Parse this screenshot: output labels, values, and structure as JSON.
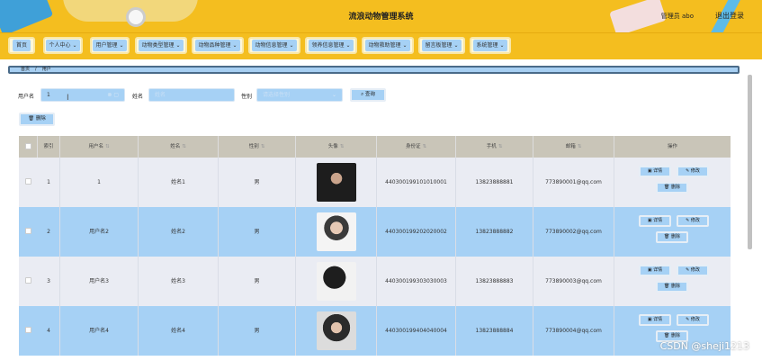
{
  "header": {
    "title": "流浪动物管理系统",
    "user_info": "管理员 abo",
    "logout": "退出登录"
  },
  "nav": [
    {
      "label": "首页"
    },
    {
      "label": "个人中心 ⌄"
    },
    {
      "label": "用户管理 ⌄"
    },
    {
      "label": "动物类型管理 ⌄"
    },
    {
      "label": "动物品种管理 ⌄"
    },
    {
      "label": "动物信息管理 ⌄"
    },
    {
      "label": "领养信息管理 ⌄"
    },
    {
      "label": "动物救助管理 ⌄"
    },
    {
      "label": "留言板管理 ⌄"
    },
    {
      "label": "系统管理 ⌄"
    }
  ],
  "breadcrumb": {
    "home": "首页",
    "separator": "/",
    "current": "用户"
  },
  "search": {
    "username_label": "用户名",
    "username_value": "1",
    "name_label": "姓名",
    "name_placeholder": "姓名",
    "gender_label": "性别",
    "gender_placeholder": "请选择性别",
    "query_button": "⌕ 查询",
    "delete_button": "🗑 删除"
  },
  "table": {
    "headers": [
      "索引",
      "用户名",
      "姓名",
      "性别",
      "头像",
      "身份证",
      "手机",
      "邮箱",
      "操作"
    ],
    "rows": [
      {
        "index": "1",
        "username": "1",
        "name": "姓名1",
        "gender": "男",
        "id_card": "440300199101010001",
        "phone": "13823888881",
        "email": "773890001@qq.com"
      },
      {
        "index": "2",
        "username": "用户名2",
        "name": "姓名2",
        "gender": "男",
        "id_card": "440300199202020002",
        "phone": "13823888882",
        "email": "773890002@qq.com"
      },
      {
        "index": "3",
        "username": "用户名3",
        "name": "姓名3",
        "gender": "男",
        "id_card": "440300199303030003",
        "phone": "13823888883",
        "email": "773890003@qq.com"
      },
      {
        "index": "4",
        "username": "用户名4",
        "name": "姓名4",
        "gender": "男",
        "id_card": "440300199404040004",
        "phone": "13823888884",
        "email": "773890004@qq.com"
      }
    ],
    "op_detail": "▣ 详情",
    "op_edit": "✎ 修改",
    "op_delete": "🗑 删除"
  },
  "watermark": "CSDN @sheji1213",
  "colors": {
    "header": "#f4be1f",
    "accent": "#a6d1f5",
    "row_odd": "#eaecf3"
  }
}
